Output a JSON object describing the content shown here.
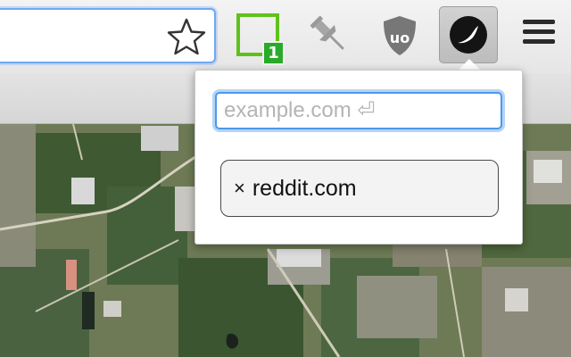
{
  "toolbar": {
    "star_icon": "star-outline-icon",
    "extensions": [
      {
        "icon": "green-square-icon",
        "badge": "1"
      },
      {
        "icon": "pushpin-icon"
      },
      {
        "icon": "ublock-shield-icon",
        "label": "uo"
      },
      {
        "icon": "dark-circle-moon-icon",
        "active": true
      }
    ],
    "menu_icon": "hamburger-menu-icon"
  },
  "popup": {
    "input_placeholder": "example.com ⏎",
    "input_value": "",
    "sites": [
      {
        "remove_symbol": "×",
        "label": "reddit.com"
      }
    ]
  },
  "colors": {
    "input_focus": "#4c98ee",
    "badge_green": "#2aaa2a",
    "green_icon": "#5ec21a"
  }
}
